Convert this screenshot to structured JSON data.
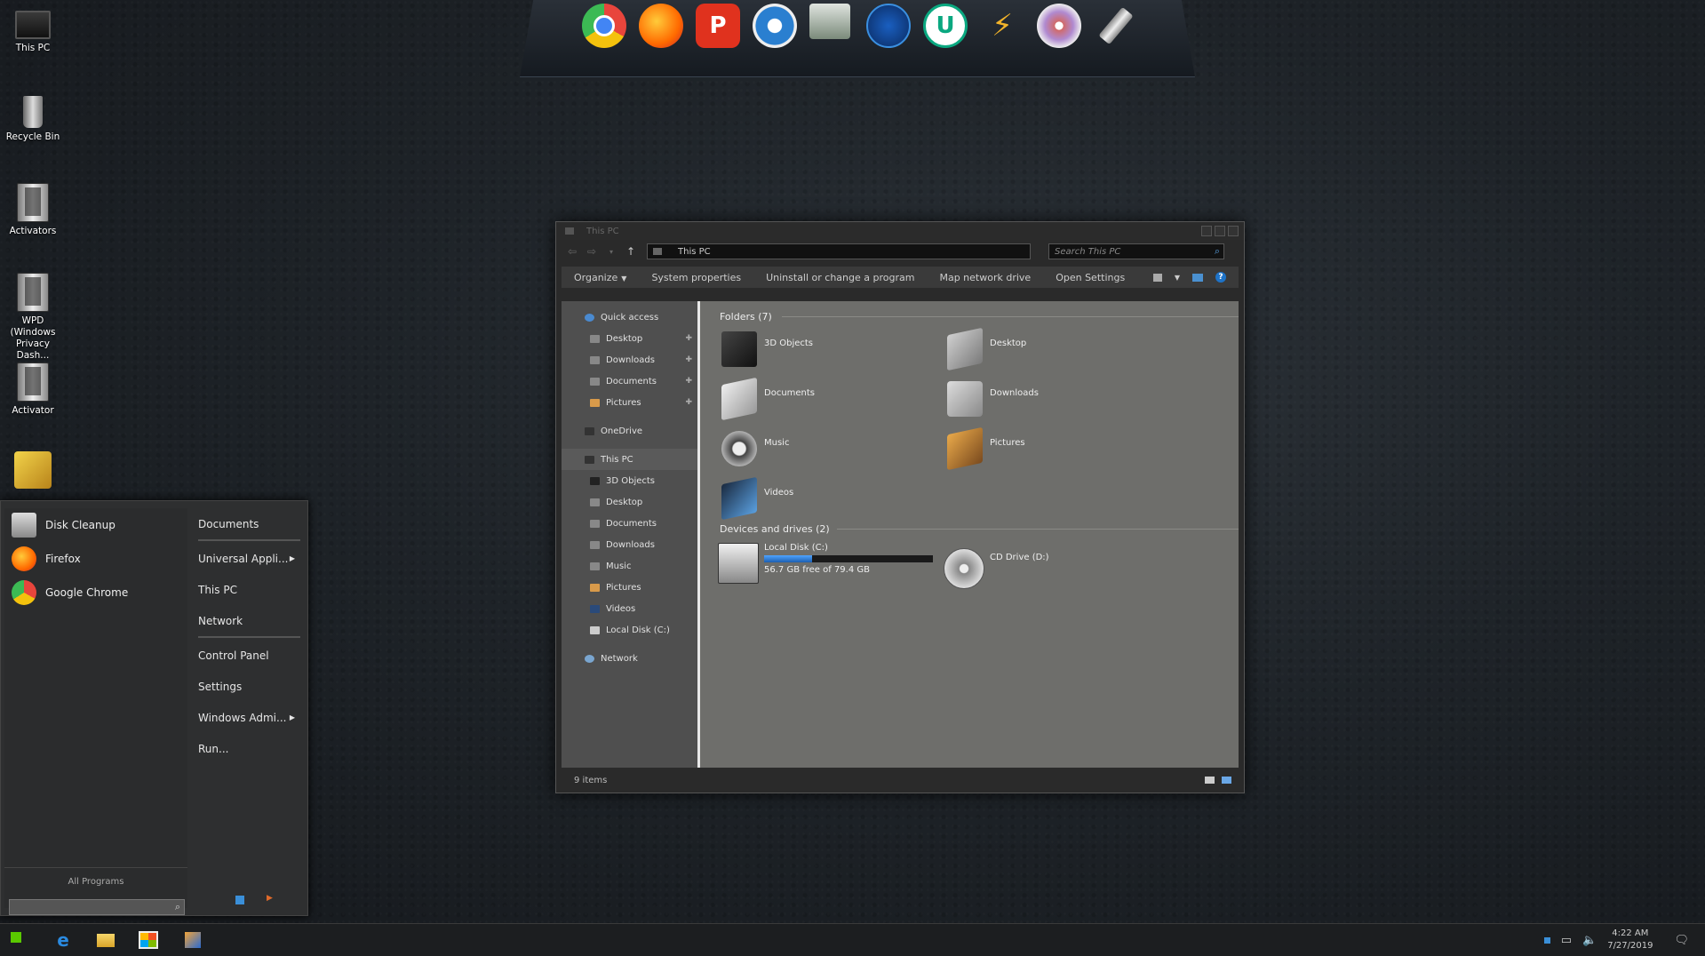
{
  "desktop": {
    "icons": [
      {
        "label": "This PC"
      },
      {
        "label": "Recycle Bin"
      },
      {
        "label": "Activators"
      },
      {
        "label": "WPD (Windows Privacy Dash..."
      },
      {
        "label": "Activator"
      },
      {
        "label": ""
      }
    ]
  },
  "dock": {
    "items": [
      {
        "name": "chrome-icon",
        "color": "#e8453c"
      },
      {
        "name": "firefox-icon",
        "color": "#ff7a1a"
      },
      {
        "name": "p-app-icon",
        "glyph": "P",
        "color": "#e0321e"
      },
      {
        "name": "settings-gear-icon",
        "color": "#2a7fd0"
      },
      {
        "name": "monitor-icon",
        "color": "#6a7a6a"
      },
      {
        "name": "dots-app-icon",
        "color": "#1a6ad0"
      },
      {
        "name": "u-app-icon",
        "glyph": "U",
        "color": "#0aa880"
      },
      {
        "name": "lightning-app-icon",
        "color": "#d89a2a"
      },
      {
        "name": "disc-icon",
        "color": "#b08ad0"
      },
      {
        "name": "usb-drive-icon",
        "color": "#bbbbbb"
      }
    ]
  },
  "explorer": {
    "title": "This PC",
    "address": "This PC",
    "search_placeholder": "Search This PC",
    "commands": {
      "organize": "Organize",
      "system_properties": "System properties",
      "uninstall": "Uninstall or change a program",
      "map_drive": "Map network drive",
      "open_settings": "Open Settings"
    },
    "nav": {
      "quick_access": "Quick access",
      "qa_items": [
        "Desktop",
        "Downloads",
        "Documents",
        "Pictures"
      ],
      "onedrive": "OneDrive",
      "this_pc": "This PC",
      "pc_items": [
        "3D Objects",
        "Desktop",
        "Documents",
        "Downloads",
        "Music",
        "Pictures",
        "Videos",
        "Local Disk (C:)"
      ],
      "network": "Network"
    },
    "folders_header": "Folders (7)",
    "folders": [
      "3D Objects",
      "Desktop",
      "Documents",
      "Downloads",
      "Music",
      "Pictures",
      "Videos"
    ],
    "drives_header": "Devices and drives (2)",
    "drives": {
      "c_name": "Local Disk (C:)",
      "c_free": "56.7 GB free of 79.4 GB",
      "c_used_fraction": 0.286,
      "d_name": "CD Drive (D:)"
    },
    "status": "9 items"
  },
  "start_menu": {
    "programs": [
      "Disk Cleanup",
      "Firefox",
      "Google Chrome"
    ],
    "right": {
      "documents": "Documents",
      "universal": "Universal Appli...",
      "this_pc": "This PC",
      "network": "Network",
      "control_panel": "Control Panel",
      "settings": "Settings",
      "windows_admin": "Windows Admi...",
      "run": "Run..."
    },
    "all_programs": "All Programs"
  },
  "taskbar": {
    "time": "4:22 AM",
    "date": "7/27/2019"
  }
}
